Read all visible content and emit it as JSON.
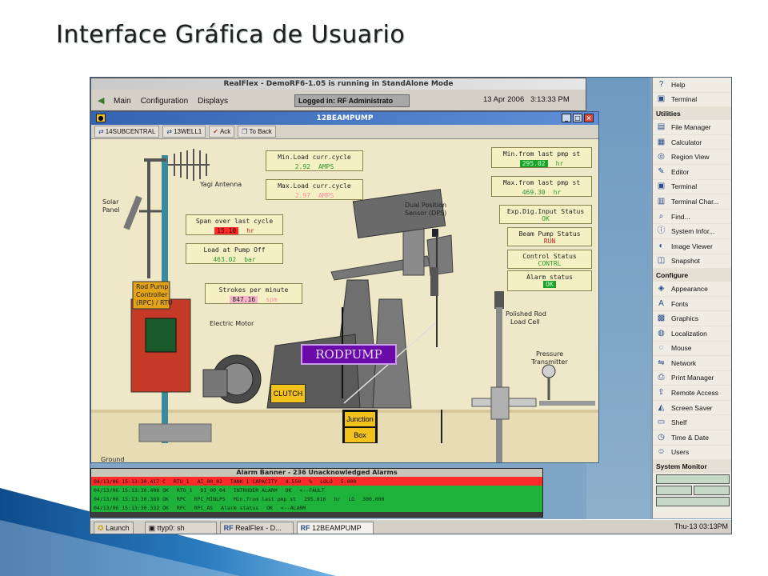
{
  "slide_title": "Interface Gráfica de Usuario",
  "realflex": {
    "title": "RealFlex - DemoRF6-1.05 is running in StandAlone Mode",
    "menu": [
      "Main",
      "Configuration",
      "Displays"
    ],
    "logged_in": "Logged in: RF Administrato",
    "date": "13 Apr 2006",
    "time": "3:13:33 PM"
  },
  "pump_window": {
    "title": "12BEAMPUMP",
    "toolbar": [
      "14SUBCENTRAL",
      "13WELL1",
      "Ack",
      "To Back"
    ]
  },
  "labels": {
    "yagi": "Yagi Antenna",
    "solar": "Solar",
    "panel": "Panel",
    "rpc_line1": "Rod Pump",
    "rpc_line2": "Controller",
    "rpc_line3": "(RPC) / RTU",
    "motor": "Electric Motor",
    "dps_line1": "Dual Position",
    "dps_line2": "Sensor (DPS)",
    "polished_line1": "Polished Rod",
    "polished_line2": "Load Cell",
    "pressure_line1": "Pressure",
    "pressure_line2": "Transmitter",
    "rodpump": "RODPUMP",
    "clutch": "CLUTCH",
    "junction": "Junction",
    "box": "Box",
    "ground": "Ground"
  },
  "panels": {
    "min_load": {
      "label": "Min.Load curr.cycle",
      "value": "2.92",
      "unit": "AMPS"
    },
    "max_load": {
      "label": "Max.Load curr.cycle",
      "value": "2.97",
      "unit": "AMPS"
    },
    "span": {
      "label": "Span over last cycle",
      "value": "15.10",
      "unit": "hr"
    },
    "load_off": {
      "label": "Load at Pump Off",
      "value": "463.02",
      "unit": "bar"
    },
    "strokes": {
      "label": "Strokes per minute",
      "value": "847.16",
      "unit": "spm"
    },
    "min_last": {
      "label": "Min.from last pmp st",
      "value": "295.02",
      "unit": "hr"
    },
    "max_last": {
      "label": "Max.from last pmp st",
      "value": "469.30",
      "unit": "hr"
    },
    "exp_dig": {
      "label": "Exp.Dig.Input Status",
      "value": "OK"
    },
    "beam": {
      "label": "Beam Pump Status",
      "value": "RUN"
    },
    "control": {
      "label": "Control Status",
      "value": "CONTRL"
    },
    "alarm_status": {
      "label": "Alarm status",
      "value": "OK"
    }
  },
  "alarm_banner": {
    "title": "Alarm Banner - 236 Unacknowledged Alarms",
    "rows": [
      {
        "date": "04/13/06 15:13:30.417 C",
        "src": "RTU_1",
        "tag": "AI_00_02",
        "desc": "TANK 1 CAPACITY",
        "val": "4.550",
        "unit": "%",
        "lim": "LOLO",
        "limval": "5.000",
        "color": "red"
      },
      {
        "date": "04/13/06 15:13:30.408 OK",
        "src": "RTU_1",
        "tag": "DI_00_04",
        "desc": "INTRUDER ALARM",
        "val": "OK",
        "unit": "<--FAULT",
        "lim": "",
        "limval": "",
        "color": "green"
      },
      {
        "date": "04/13/06 15:13:30.369 OK",
        "src": "RPC",
        "tag": "RPC_MINLPS",
        "desc": "Min.from last pmp st",
        "val": "295.016",
        "unit": "hr",
        "lim": "LO",
        "limval": "300.000",
        "color": "green"
      },
      {
        "date": "04/13/06 15:13:30.332 OK",
        "src": "RPC",
        "tag": "RPC_AS",
        "desc": "Alarm status",
        "val": "OK",
        "unit": "<--ALARM",
        "lim": "",
        "limval": "",
        "color": "green"
      }
    ]
  },
  "taskbar": {
    "launch": "Launch",
    "tasks": [
      "ttyp0: sh",
      "RealFlex - D...",
      "12BEAMPUMP"
    ],
    "clock": "Thu-13 03:13PM"
  },
  "right_menu": {
    "top_items": [
      {
        "label": "Help",
        "icon": "help-icon"
      },
      {
        "label": "Terminal",
        "icon": "terminal-icon"
      }
    ],
    "utilities_label": "Utilities",
    "utilities": [
      {
        "label": "File Manager",
        "icon": "file-manager-icon"
      },
      {
        "label": "Calculator",
        "icon": "calculator-icon"
      },
      {
        "label": "Region View",
        "icon": "region-view-icon"
      },
      {
        "label": "Editor",
        "icon": "editor-icon"
      },
      {
        "label": "Terminal",
        "icon": "terminal-icon"
      },
      {
        "label": "Terminal Char...",
        "icon": "terminal-char-icon"
      },
      {
        "label": "Find...",
        "icon": "find-icon"
      },
      {
        "label": "System Infor...",
        "icon": "system-info-icon"
      },
      {
        "label": "Image Viewer",
        "icon": "image-viewer-icon"
      },
      {
        "label": "Snapshot",
        "icon": "snapshot-icon"
      }
    ],
    "configure_label": "Configure",
    "configure": [
      {
        "label": "Appearance",
        "icon": "appearance-icon"
      },
      {
        "label": "Fonts",
        "icon": "fonts-icon"
      },
      {
        "label": "Graphics",
        "icon": "graphics-icon"
      },
      {
        "label": "Localization",
        "icon": "localization-icon"
      },
      {
        "label": "Mouse",
        "icon": "mouse-icon"
      },
      {
        "label": "Network",
        "icon": "network-icon"
      },
      {
        "label": "Print Manager",
        "icon": "print-manager-icon"
      },
      {
        "label": "Remote Access",
        "icon": "remote-access-icon"
      },
      {
        "label": "Screen Saver",
        "icon": "screen-saver-icon"
      },
      {
        "label": "Shelf",
        "icon": "shelf-icon"
      },
      {
        "label": "Time & Date",
        "icon": "time-date-icon"
      },
      {
        "label": "Users",
        "icon": "users-icon"
      }
    ],
    "monitor_label": "System Monitor"
  }
}
